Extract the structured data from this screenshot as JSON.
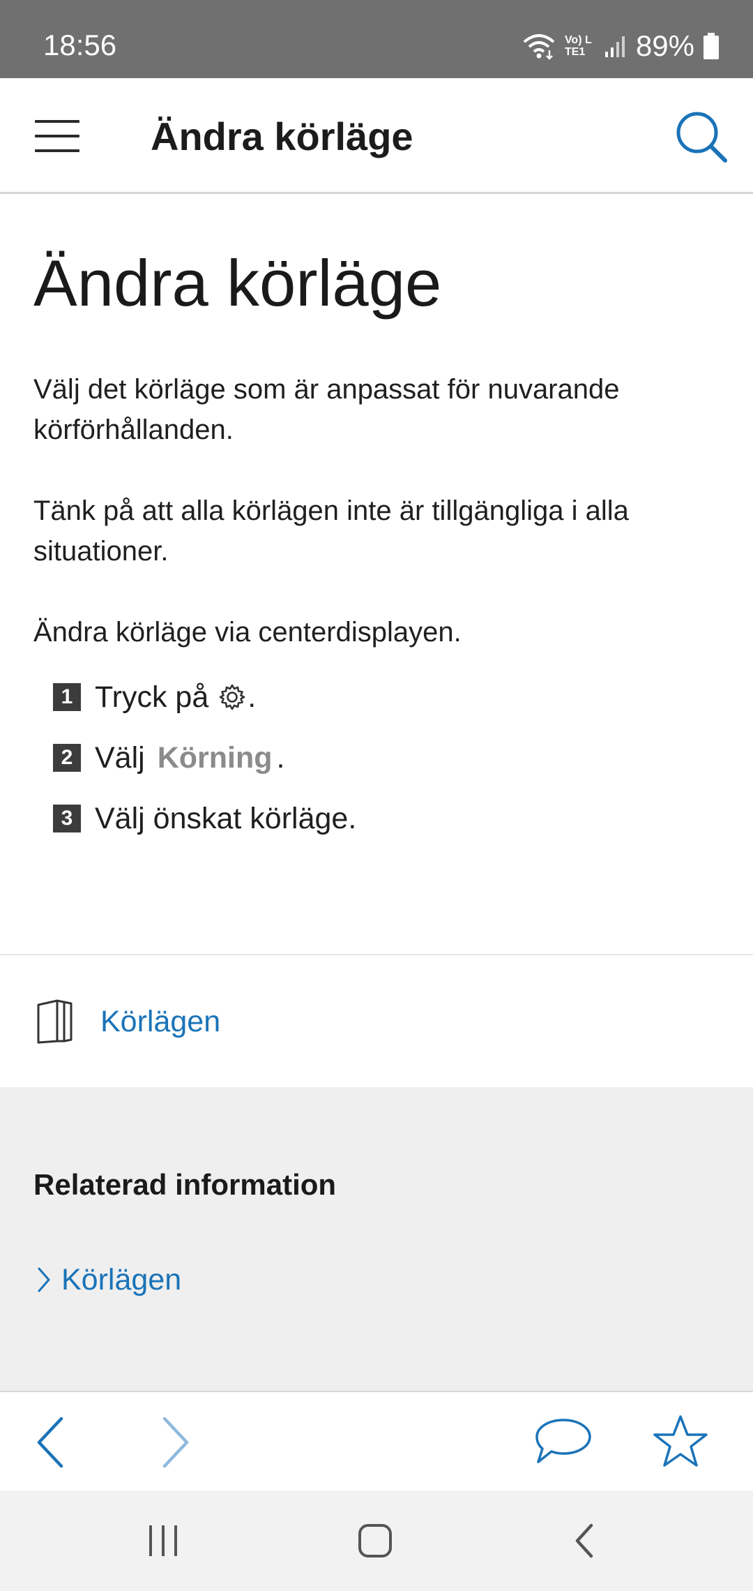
{
  "status_bar": {
    "time": "18:56",
    "network_label": "Vo) LTE1",
    "battery": "89%"
  },
  "app_bar": {
    "title": "Ändra körläge",
    "icons": {
      "menu": "hamburger-menu-icon",
      "search": "search-icon"
    },
    "accent_color": "#1a73b8"
  },
  "article": {
    "title": "Ändra körläge",
    "paragraphs": [
      "Välj det körläge som är anpassat för nuvarande körförhållanden.",
      "Tänk på att alla körlägen inte är tillgängliga i alla situationer.",
      "Ändra körläge via centerdisplayen."
    ],
    "steps": [
      {
        "number": "1",
        "text": "Tryck på",
        "icon": "gear-icon",
        "suffix": "."
      },
      {
        "number": "2",
        "text": "Välj",
        "emphasis": "Körning",
        "suffix": "."
      },
      {
        "number": "3",
        "text": "Välj önskat körläge."
      }
    ]
  },
  "manual_link": {
    "icon": "book-icon",
    "label": "Körlägen"
  },
  "related": {
    "heading": "Relaterad information",
    "links": [
      {
        "label": "Körlägen",
        "icon": "chevron-right-icon"
      }
    ]
  },
  "bottom_toolbar": {
    "icons": [
      "back-arrow-icon",
      "forward-arrow-icon",
      "feedback-chat-icon",
      "favorite-star-icon"
    ]
  },
  "system_nav": {
    "icons": [
      "recent-apps-icon",
      "home-icon",
      "system-back-icon"
    ]
  }
}
